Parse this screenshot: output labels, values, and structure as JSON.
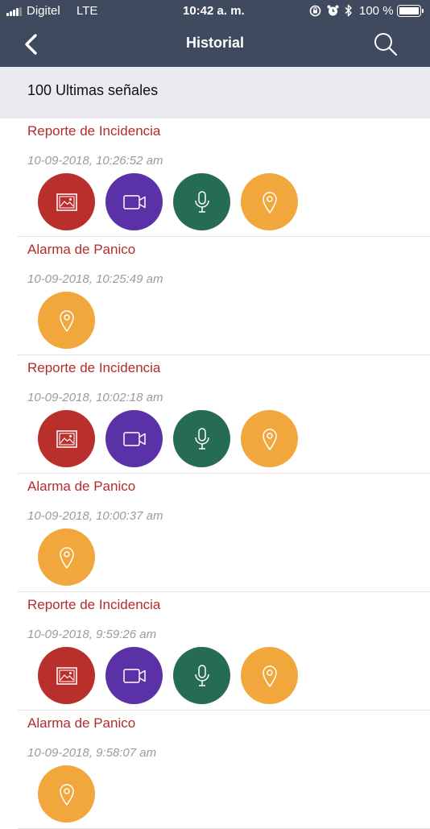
{
  "status_bar": {
    "carrier": "Digitel",
    "network": "LTE",
    "time": "10:42 a. m.",
    "battery": "100 %",
    "battery_level": 1.0
  },
  "nav": {
    "title": "Historial"
  },
  "section": {
    "title": "100 Ultimas señales"
  },
  "colors": {
    "header_bg": "#3f4a5e",
    "title_red": "#b32c2c",
    "image": "#b82f2c",
    "video": "#5b31a8",
    "audio": "#256b55",
    "location": "#f2a73c"
  },
  "items": [
    {
      "title": "Reporte de Incidencia",
      "time": "10-09-2018, 10:26:52 am",
      "icons": [
        "image-icon",
        "video-icon",
        "microphone-icon",
        "location-pin-icon"
      ]
    },
    {
      "title": "Alarma de Panico",
      "time": "10-09-2018, 10:25:49 am",
      "icons": [
        "location-pin-icon"
      ]
    },
    {
      "title": "Reporte de Incidencia",
      "time": "10-09-2018, 10:02:18 am",
      "icons": [
        "image-icon",
        "video-icon",
        "microphone-icon",
        "location-pin-icon"
      ]
    },
    {
      "title": "Alarma de Panico",
      "time": "10-09-2018, 10:00:37 am",
      "icons": [
        "location-pin-icon"
      ]
    },
    {
      "title": "Reporte de Incidencia",
      "time": "10-09-2018, 9:59:26 am",
      "icons": [
        "image-icon",
        "video-icon",
        "microphone-icon",
        "location-pin-icon"
      ]
    },
    {
      "title": "Alarma de Panico",
      "time": "10-09-2018, 9:58:07 am",
      "icons": [
        "location-pin-icon"
      ]
    }
  ]
}
